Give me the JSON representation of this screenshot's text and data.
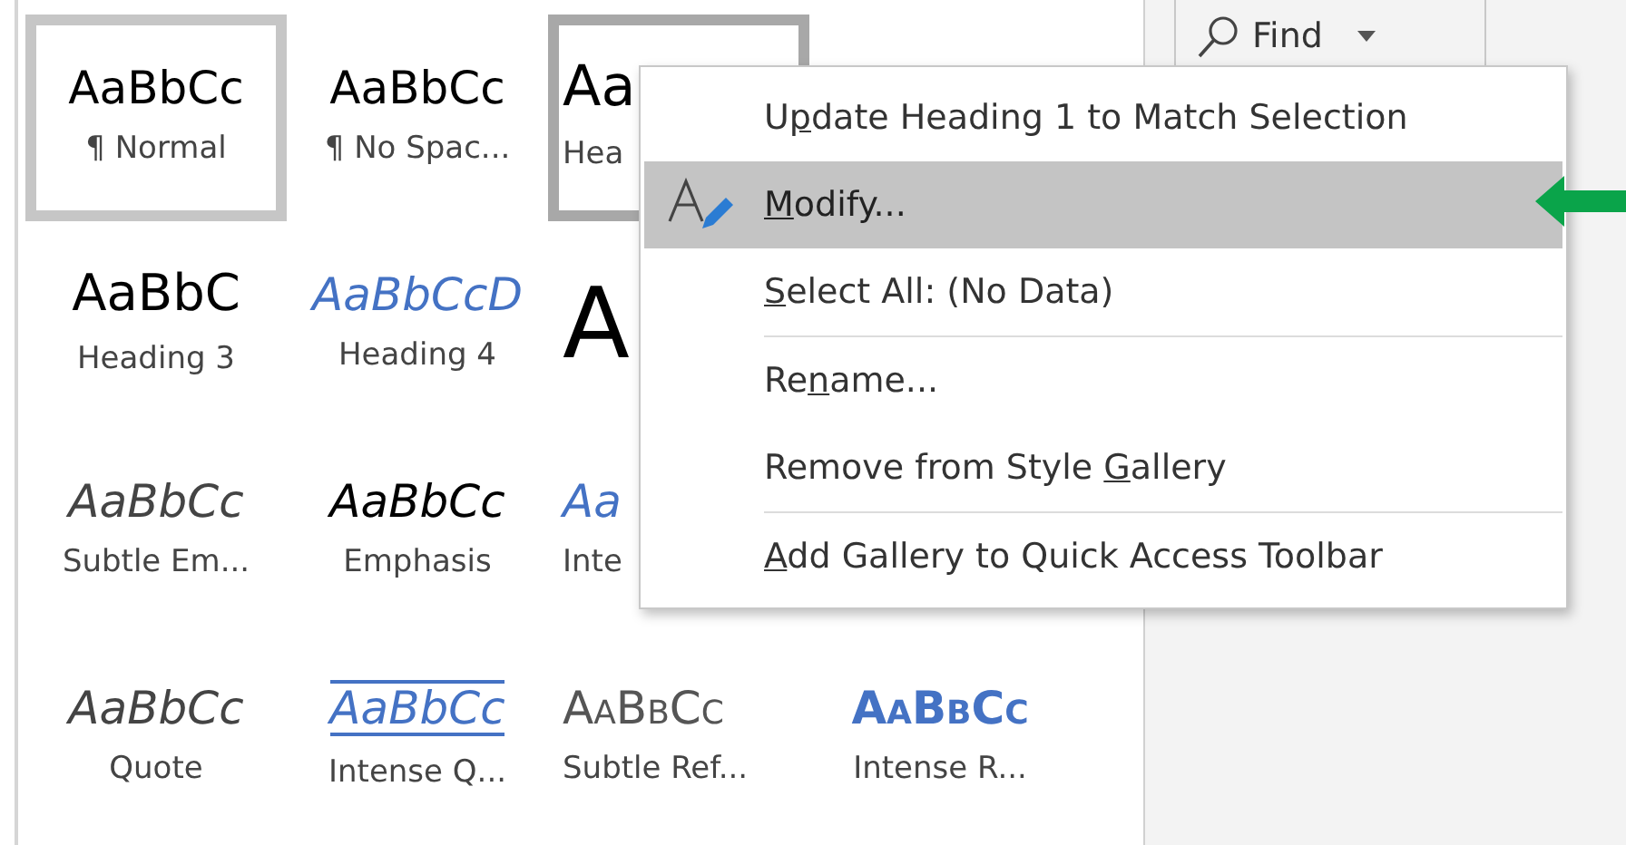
{
  "style_gallery": [
    [
      {
        "preview": "AaBbCc",
        "label": "¶ Normal",
        "kind": "normal",
        "selected": true,
        "hovered": false
      },
      {
        "preview": "AaBbCc",
        "label": "¶ No Spac...",
        "kind": "normal",
        "selected": false,
        "hovered": false
      },
      {
        "preview": "Aa",
        "label": "Hea",
        "kind": "heading1",
        "selected": false,
        "hovered": true
      }
    ],
    [
      {
        "preview": "AaBbC",
        "label": "Heading 3",
        "kind": "heading3",
        "selected": false,
        "hovered": false
      },
      {
        "preview": "AaBbCcD",
        "label": "Heading 4",
        "kind": "heading4",
        "selected": false,
        "hovered": false
      },
      {
        "preview": "A",
        "kind": "title",
        "selected": false,
        "hovered": false
      }
    ],
    [
      {
        "preview": "AaBbCc",
        "label": "Subtle Em...",
        "kind": "subtle",
        "selected": false,
        "hovered": false
      },
      {
        "preview": "AaBbCc",
        "label": "Emphasis",
        "kind": "emphasis",
        "selected": false,
        "hovered": false
      },
      {
        "preview": "Aa",
        "label": "Inte",
        "kind": "intense",
        "selected": false,
        "hovered": false
      }
    ],
    [
      {
        "preview": "AaBbCc",
        "label": "Quote",
        "kind": "subtle",
        "selected": false,
        "hovered": false
      },
      {
        "preview": "AaBbCc",
        "label": "Intense Q...",
        "kind": "intensequote",
        "selected": false,
        "hovered": false
      },
      {
        "preview": "AaBbCc",
        "label": "Subtle Ref...",
        "kind": "subtleref",
        "selected": false,
        "hovered": false
      },
      {
        "preview": "AaBbCc",
        "label": "Intense R...",
        "kind": "intenseref",
        "selected": false,
        "hovered": false
      }
    ]
  ],
  "find_button": {
    "label": "Find"
  },
  "context_menu": [
    {
      "kind": "item",
      "text_before": "U",
      "access_key": "p",
      "text_after": "date Heading 1 to Match Selection",
      "selected": false
    },
    {
      "kind": "icon_item",
      "access_key": "M",
      "text_after": "odify...",
      "selected": true
    },
    {
      "kind": "item",
      "access_key": "S",
      "text_after": "elect All: (No Data)",
      "selected": false
    },
    {
      "kind": "separator"
    },
    {
      "kind": "item",
      "text_before": "Re",
      "access_key": "n",
      "text_after": "ame...",
      "selected": false
    },
    {
      "kind": "item",
      "text_before": "Remove from Style ",
      "access_key": "G",
      "text_after": "allery",
      "selected": false
    },
    {
      "kind": "separator"
    },
    {
      "kind": "item",
      "access_key": "A",
      "text_after": "dd Gallery to Quick Access Toolbar",
      "selected": false
    }
  ]
}
